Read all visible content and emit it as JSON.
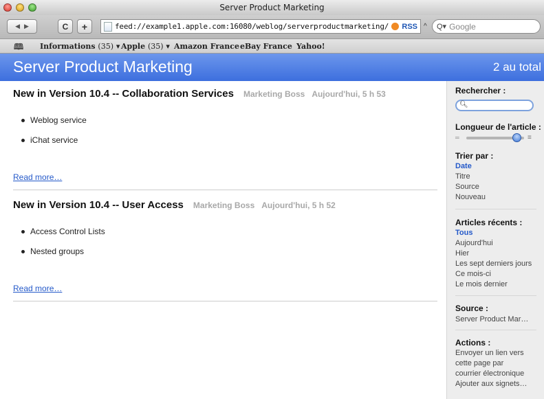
{
  "window": {
    "title": "Server Product Marketing"
  },
  "toolbar": {
    "address": "feed://example1.apple.com:16080/weblog/serverproductmarketing/",
    "rss_label": "RSS",
    "search_placeholder": "Google",
    "reload_label": "C",
    "add_label": "+"
  },
  "bookmarks": [
    {
      "label": "Informations",
      "count": "(35)"
    },
    {
      "label": "Apple",
      "count": "(35)"
    },
    {
      "label": "Amazon France",
      "count": ""
    },
    {
      "label": "eBay France",
      "count": ""
    },
    {
      "label": "Yahoo!",
      "count": ""
    }
  ],
  "header": {
    "title": "Server Product Marketing",
    "count": "2 au total"
  },
  "posts": [
    {
      "title": "New in Version 10.4 -- Collaboration Services",
      "author": "Marketing Boss",
      "date": "Aujourd'hui, 5 h 53",
      "items": [
        "Weblog service",
        "iChat service"
      ],
      "read_more": "Read more…"
    },
    {
      "title": "New in Version 10.4 -- User Access",
      "author": "Marketing Boss",
      "date": "Aujourd'hui, 5 h 52",
      "items": [
        "Access Control Lists",
        "Nested groups"
      ],
      "read_more": "Read more…"
    }
  ],
  "sidebar": {
    "search_label": "Rechercher :",
    "length_label": "Longueur de l'article :",
    "sort_label": "Trier par :",
    "sort_options": [
      "Date",
      "Titre",
      "Source",
      "Nouveau"
    ],
    "recent_label": "Articles récents :",
    "recent_options": [
      "Tous",
      "Aujourd'hui",
      "Hier",
      "Les sept derniers jours",
      "Ce mois-ci",
      "Le mois dernier"
    ],
    "source_label": "Source :",
    "source_value": "Server Product Mar…",
    "actions_label": "Actions :",
    "actions": [
      "Envoyer un lien vers",
      "cette page par",
      "courrier électronique",
      "Ajouter aux signets…"
    ],
    "slider_level": 0.92
  },
  "colors": {
    "header_blue": "#4a7be3",
    "link_blue": "#2459c9"
  }
}
